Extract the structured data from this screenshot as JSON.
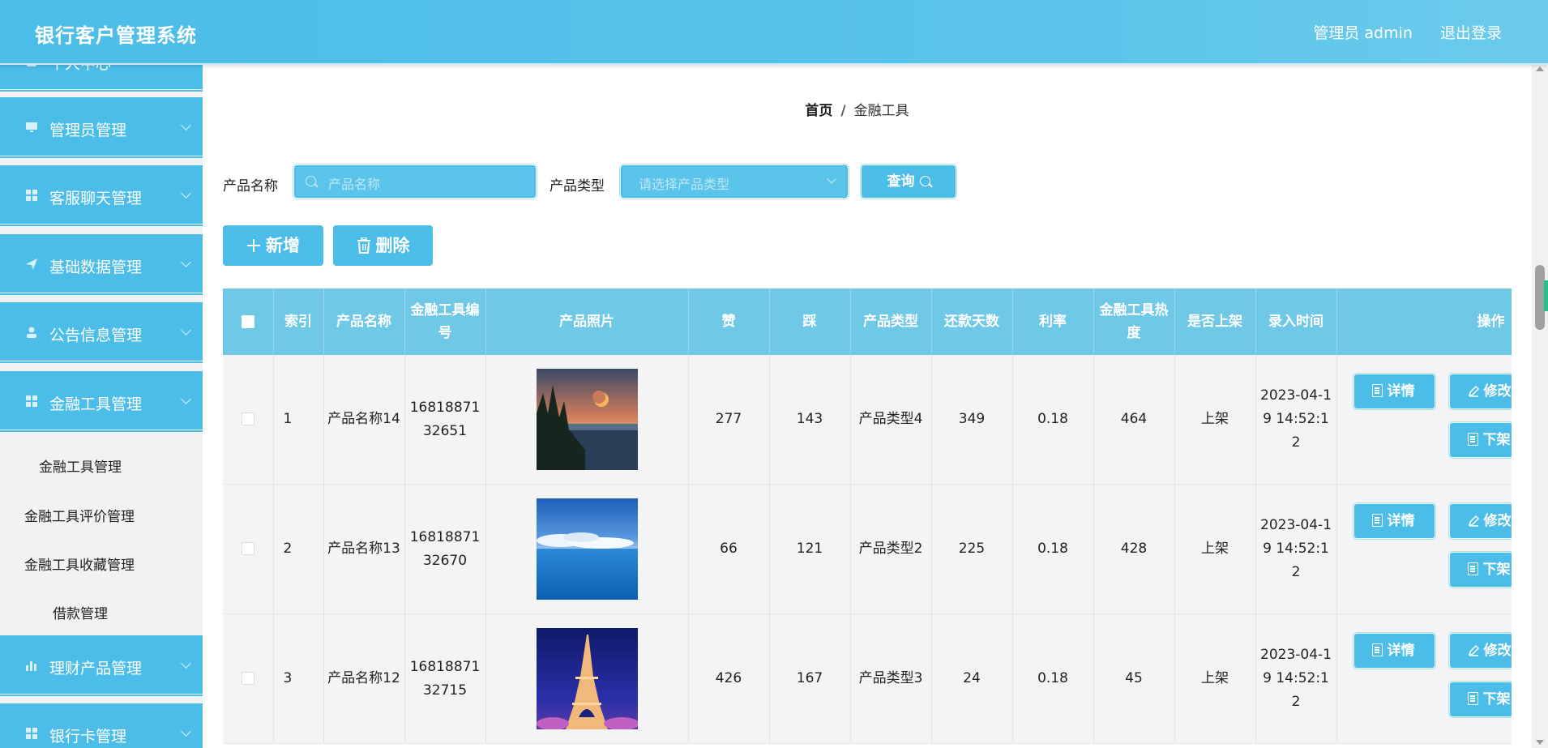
{
  "header": {
    "title": "银行客户管理系统",
    "user": "管理员 admin",
    "logout": "退出登录"
  },
  "sidebar": {
    "items": [
      {
        "label": "个人中心",
        "icon": "user-icon"
      },
      {
        "label": "管理员管理",
        "icon": "monitor-icon"
      },
      {
        "label": "客服聊天管理",
        "icon": "grid-icon"
      },
      {
        "label": "基础数据管理",
        "icon": "send-icon"
      },
      {
        "label": "公告信息管理",
        "icon": "user-icon"
      },
      {
        "label": "金融工具管理",
        "icon": "grid-icon"
      },
      {
        "label": "理财产品管理",
        "icon": "bar-chart-icon"
      },
      {
        "label": "银行卡管理",
        "icon": "grid-icon"
      }
    ],
    "subitems": [
      "金融工具管理",
      "金融工具评价管理",
      "金融工具收藏管理",
      "借款管理"
    ]
  },
  "breadcrumb": {
    "home": "首页",
    "separator": "/",
    "current": "金融工具"
  },
  "filters": {
    "name_label": "产品名称",
    "name_placeholder": "产品名称",
    "type_label": "产品类型",
    "type_placeholder": "请选择产品类型",
    "query_label": "查询"
  },
  "actions": {
    "add": "新增",
    "delete": "删除"
  },
  "table": {
    "headers": [
      "索引",
      "产品名称",
      "金融工具编号",
      "产品照片",
      "赞",
      "踩",
      "产品类型",
      "还款天数",
      "利率",
      "金融工具热度",
      "是否上架",
      "录入时间",
      "操作"
    ],
    "ops": {
      "detail": "详情",
      "edit": "修改",
      "offline": "下架"
    },
    "rows": [
      {
        "index": "1",
        "name": "产品名称14",
        "code": "1681887132651",
        "photo": "photo-lake-moon",
        "like": "277",
        "dislike": "143",
        "type": "产品类型4",
        "days": "349",
        "rate": "0.18",
        "heat": "464",
        "status": "上架",
        "time": "2023-04-19 14:52:12"
      },
      {
        "index": "2",
        "name": "产品名称13",
        "code": "1681887132670",
        "photo": "photo-sea-clouds",
        "like": "66",
        "dislike": "121",
        "type": "产品类型2",
        "days": "225",
        "rate": "0.18",
        "heat": "428",
        "status": "上架",
        "time": "2023-04-19 14:52:12"
      },
      {
        "index": "3",
        "name": "产品名称12",
        "code": "1681887132715",
        "photo": "photo-eiffel-night",
        "like": "426",
        "dislike": "167",
        "type": "产品类型3",
        "days": "24",
        "rate": "0.18",
        "heat": "45",
        "status": "上架",
        "time": "2023-04-19 14:52:12"
      }
    ]
  },
  "colors": {
    "primary": "#4bbde8",
    "header_bg": "#6fc8e6",
    "row_bg": "#f4f4f4"
  }
}
